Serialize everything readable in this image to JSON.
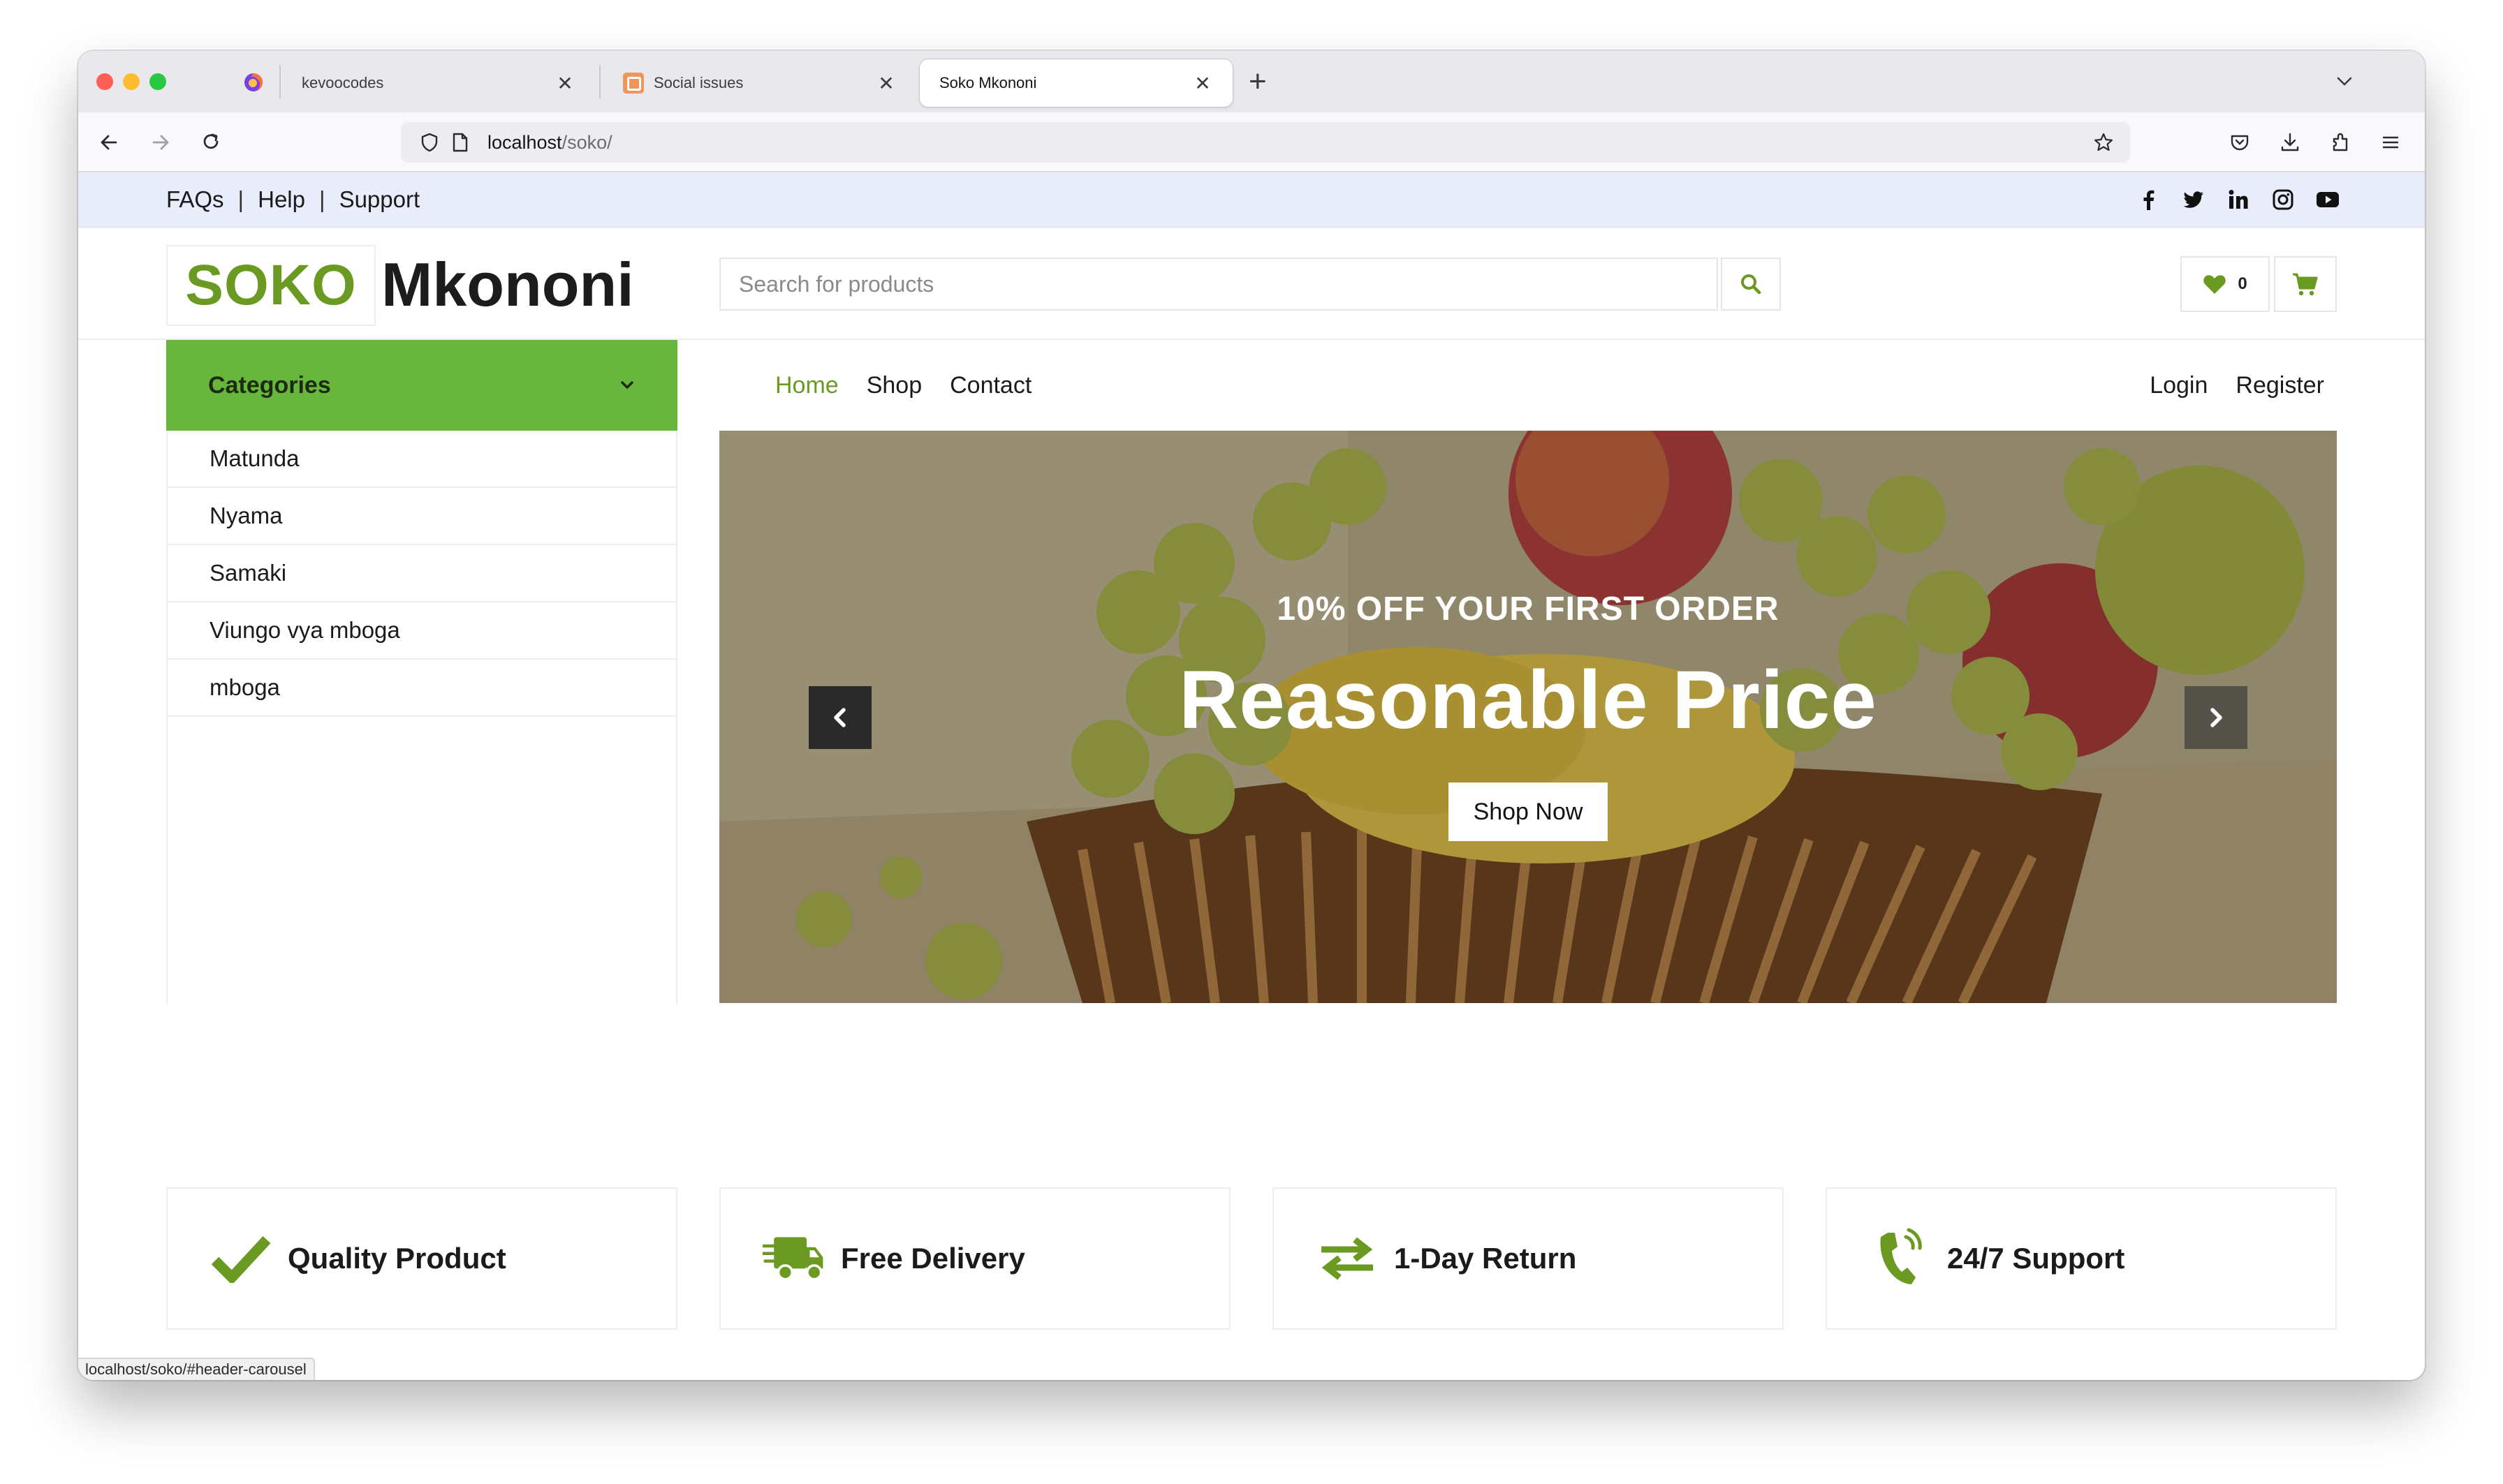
{
  "browser": {
    "tabs": [
      {
        "title": "kevoocodes"
      },
      {
        "title": "Social issues"
      },
      {
        "title": "Soko Mkononi"
      }
    ],
    "url_host": "localhost",
    "url_path": "/soko/",
    "status_url": "localhost/soko/#header-carousel"
  },
  "topbar": {
    "links": [
      "FAQs",
      "Help",
      "Support"
    ],
    "separator": "|"
  },
  "header": {
    "logo_part1": "SOKO",
    "logo_part2": "Mkononi",
    "search_placeholder": "Search for products",
    "wishlist_count": "0"
  },
  "categories": {
    "title": "Categories",
    "items": [
      "Matunda",
      "Nyama",
      "Samaki",
      "Viungo vya mboga",
      "mboga"
    ]
  },
  "nav": {
    "left": [
      "Home",
      "Shop",
      "Contact"
    ],
    "right": [
      "Login",
      "Register"
    ]
  },
  "carousel": {
    "subtitle": "10% OFF YOUR FIRST ORDER",
    "title": "Reasonable Price",
    "button": "Shop Now"
  },
  "features": [
    {
      "label": "Quality Product",
      "icon": "check-icon"
    },
    {
      "label": "Free Delivery",
      "icon": "truck-icon"
    },
    {
      "label": "1-Day Return",
      "icon": "exchange-arrows-icon"
    },
    {
      "label": "24/7 Support",
      "icon": "phone-volume-icon"
    }
  ],
  "colors": {
    "brand_green": "#6b9a23",
    "category_header": "#67b73c",
    "topbar_bg": "#e8ecfb"
  }
}
